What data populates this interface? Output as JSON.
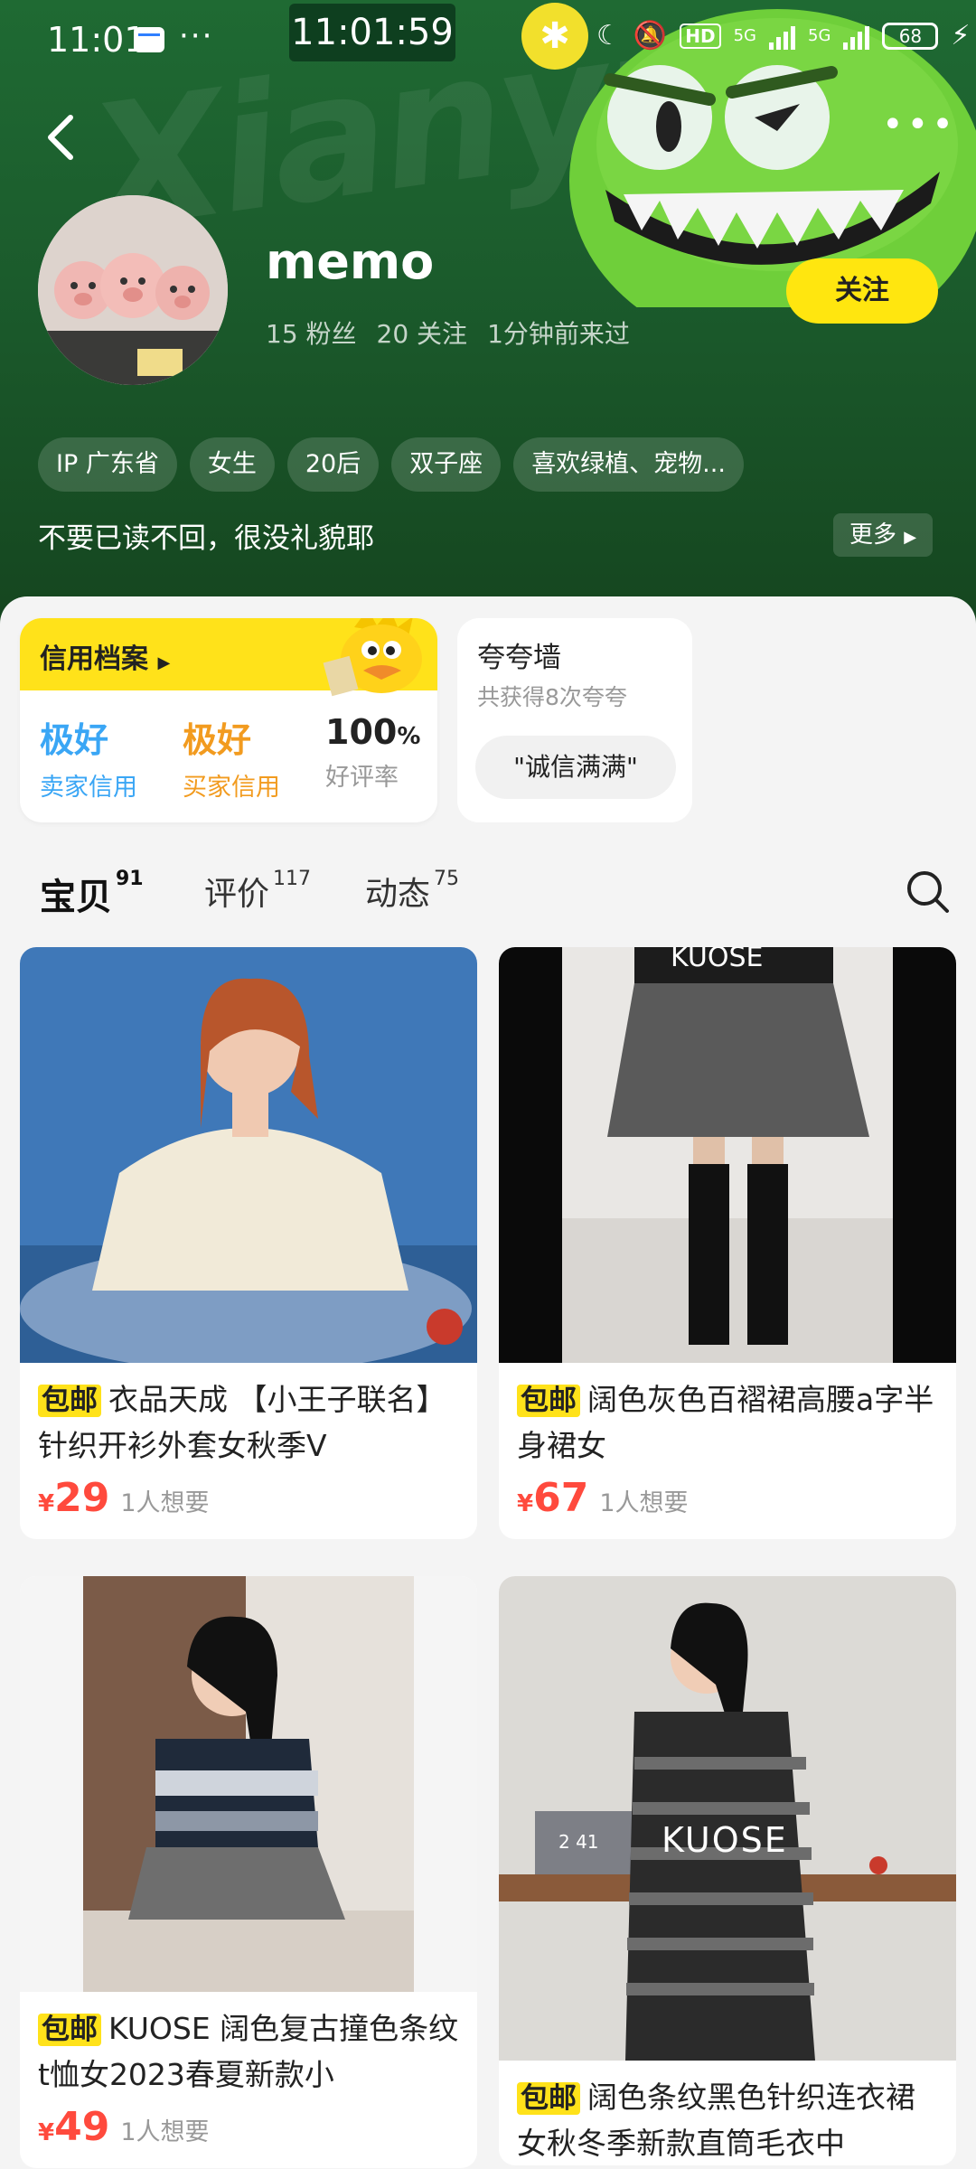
{
  "status": {
    "time": "11:01",
    "center_clock": "11:01:59",
    "signal1": "5G",
    "signal2": "5G",
    "hd_label": "HD",
    "battery": "68"
  },
  "header": {
    "watermark": "Xianyu",
    "username": "memo",
    "stats": [
      "15 粉丝",
      "20 关注",
      "1分钟前来过"
    ],
    "follow_label": "关注",
    "tags": [
      "IP 广东省",
      "女生",
      "20后",
      "双子座",
      "喜欢绿植、宠物..."
    ],
    "bio": "不要已读不回，很没礼貌耶",
    "more_label": "更多"
  },
  "credit": {
    "title": "信用档案",
    "seller_value": "极好",
    "seller_label": "卖家信用",
    "seller_color": "#3aa6f5",
    "buyer_value": "极好",
    "buyer_label": "买家信用",
    "buyer_color": "#f29b1f",
    "rate_value": "100",
    "rate_unit": "%",
    "rate_label": "好评率"
  },
  "praise": {
    "title": "夸夸墙",
    "subtitle": "共获得8次夸夸",
    "chip": "\"诚信满满\""
  },
  "tabs": [
    {
      "label": "宝贝",
      "count": "91"
    },
    {
      "label": "评价",
      "count": "117"
    },
    {
      "label": "动态",
      "count": "75"
    }
  ],
  "products": [
    {
      "badge": "包邮",
      "title": "衣品天成 【小王子联名】针织开衫外套女秋季V",
      "currency": "¥",
      "price": "29",
      "want": "1人想要"
    },
    {
      "badge": "包邮",
      "title": "阔色灰色百褶裙高腰a字半身裙女",
      "currency": "¥",
      "price": "67",
      "want": "1人想要"
    },
    {
      "badge": "包邮",
      "title": "KUOSE 阔色复古撞色条纹t恤女2023春夏新款小",
      "currency": "¥",
      "price": "49",
      "want": "1人想要"
    },
    {
      "badge": "包邮",
      "title": "阔色条纹黑色针织连衣裙女秋冬季新款直筒毛衣中",
      "currency": "",
      "price": "",
      "want": ""
    }
  ],
  "image_text": {
    "kuose_label": "KUOSE",
    "laptop_text": "2 41"
  },
  "colors": {
    "accent_yellow": "#ffe21a",
    "header_green": "#1f6a33",
    "price_red": "#ff4a3d"
  }
}
